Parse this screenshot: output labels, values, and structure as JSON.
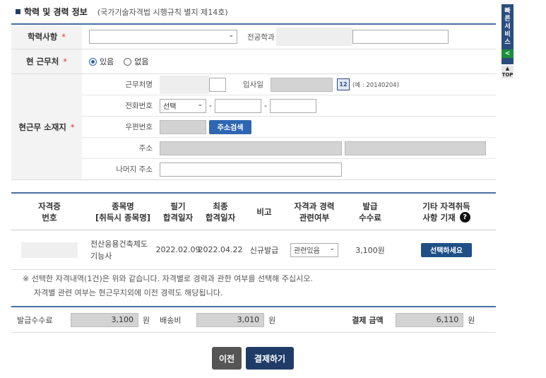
{
  "section": {
    "title": "학력 및 경력 정보",
    "law": "(국가기술자격법 시행규칙 별지 제14호)"
  },
  "education": {
    "label": "학력사항",
    "required_mark": "*",
    "major_label": "전공학과"
  },
  "current_job": {
    "label": "현 근무처",
    "required_mark": "*",
    "option_yes": "있음",
    "option_no": "없음",
    "selected": "있음"
  },
  "workplace": {
    "label": "현근무 소재지",
    "required_mark": "*",
    "company_label": "근무처명",
    "join_label": "입사일",
    "calendar_icon": "12",
    "join_hint": "(예 : 20140204)",
    "phone_label": "전화번호",
    "phone_select": "선택",
    "dash": "-",
    "zip_label": "우편번호",
    "zip_button": "주소검색",
    "address_label": "주소",
    "address_rest_label": "나머지 주소"
  },
  "qual_table": {
    "headers": {
      "number": [
        "자격증",
        "번호"
      ],
      "item": [
        "종목명",
        "[취득시 종목명]"
      ],
      "written": [
        "필기",
        "합격일자"
      ],
      "final": [
        "최종",
        "합격일자"
      ],
      "note": "비고",
      "related": [
        "자격과 경력",
        "관련여부"
      ],
      "fee": [
        "발급",
        "수수료"
      ],
      "other": [
        "기타 자격취득",
        "사항 기재"
      ],
      "help_icon": "?"
    },
    "rows": [
      {
        "item": [
          "전산응용건축제도",
          "기능사"
        ],
        "written_date": "2022.02.09",
        "final_date": "2022.04.22",
        "note": "신규발급",
        "related": "관련있음",
        "fee": "3,100원",
        "select_button": "선택하세요"
      }
    ]
  },
  "notice": {
    "line1": "※ 선택한 자격내역(1건)은 위와 같습니다. 자격별로 경력과 관한 여부를 선택해 주십시오.",
    "line2": "자격별 관련 여부는 현근무지외에 이전 경력도 해당됩니다."
  },
  "fees": {
    "issue_label": "발급수수료",
    "issue_value": "3,100",
    "unit": "원",
    "shipping_label": "배송비",
    "shipping_value": "3,010",
    "total_label": "결제 금액",
    "total_value": "6,110"
  },
  "actions": {
    "prev": "이전",
    "pay": "결제하기"
  },
  "quick": {
    "label": [
      "빠",
      "른",
      "서",
      "비",
      "스"
    ],
    "arrow": "<",
    "top": "TOP"
  },
  "colors": {
    "accent": "#4a6fa0",
    "button_blue": "#2e66b3",
    "button_dark": "#555555",
    "button_navy": "#1f3c68"
  }
}
